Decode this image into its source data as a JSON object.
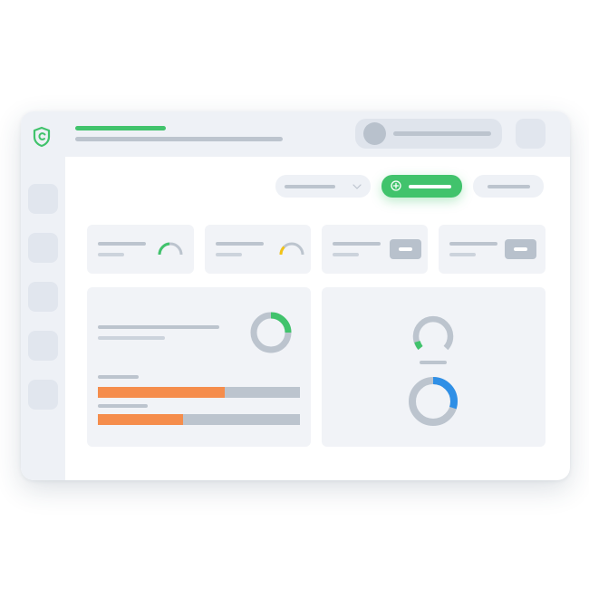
{
  "colors": {
    "accent": "#41c36c",
    "warning": "#f3c316",
    "orange": "#f58d4c",
    "blue": "#2f8fe6",
    "placeholder": "#bcc4ce",
    "panel": "#f1f3f7",
    "chrome": "#eef1f6"
  },
  "icons": {
    "logo": "shield-check-icon",
    "add": "plus-circle-icon",
    "dropdown": "chevron-down-icon"
  },
  "progress_bars": [
    {
      "fill_fraction": 0.63,
      "color": "orange"
    },
    {
      "fill_fraction": 0.42,
      "color": "orange"
    }
  ],
  "donuts": [
    {
      "fill_fraction": 0.25,
      "color": "accent"
    },
    {
      "fill_fraction": 0.3,
      "color": "blue"
    },
    {
      "fill_fraction": 0.08,
      "color": "accent"
    }
  ]
}
